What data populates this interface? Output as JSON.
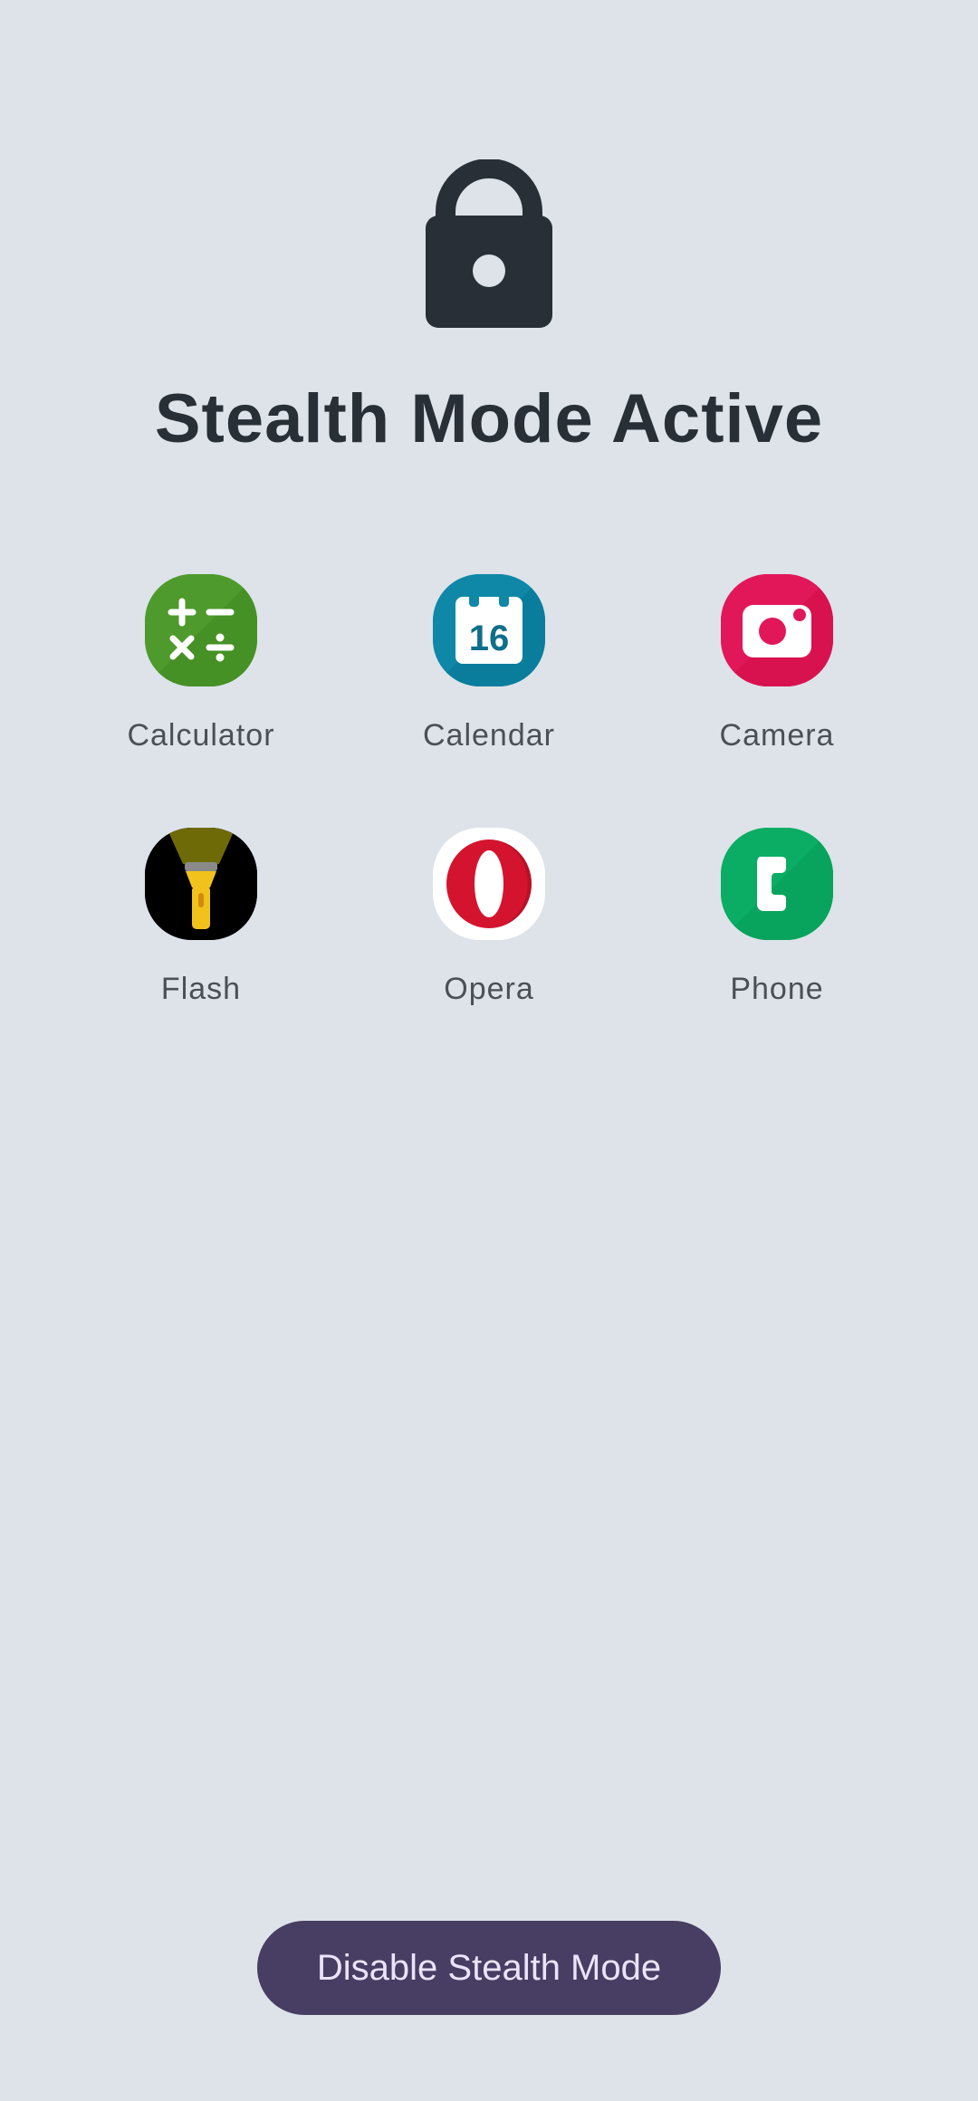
{
  "page": {
    "title": "Stealth Mode Active",
    "lock_icon": "lock-icon",
    "background_color": "#dde3e9"
  },
  "apps": [
    {
      "label": "Calculator",
      "icon": "calculator-icon",
      "color": "#4f9a2c"
    },
    {
      "label": "Calendar",
      "icon": "calendar-icon",
      "color": "#0f88a8",
      "icon_text": "16"
    },
    {
      "label": "Camera",
      "icon": "camera-icon",
      "color": "#e2175a"
    },
    {
      "label": "Flash",
      "icon": "flashlight-icon",
      "color": "#000000"
    },
    {
      "label": "Opera",
      "icon": "opera-icon",
      "color": "#d4142e"
    },
    {
      "label": "Phone",
      "icon": "phone-icon",
      "color": "#0aad63"
    }
  ],
  "footer": {
    "disable_button_label": "Disable Stealth Mode",
    "button_color": "#483e63"
  }
}
